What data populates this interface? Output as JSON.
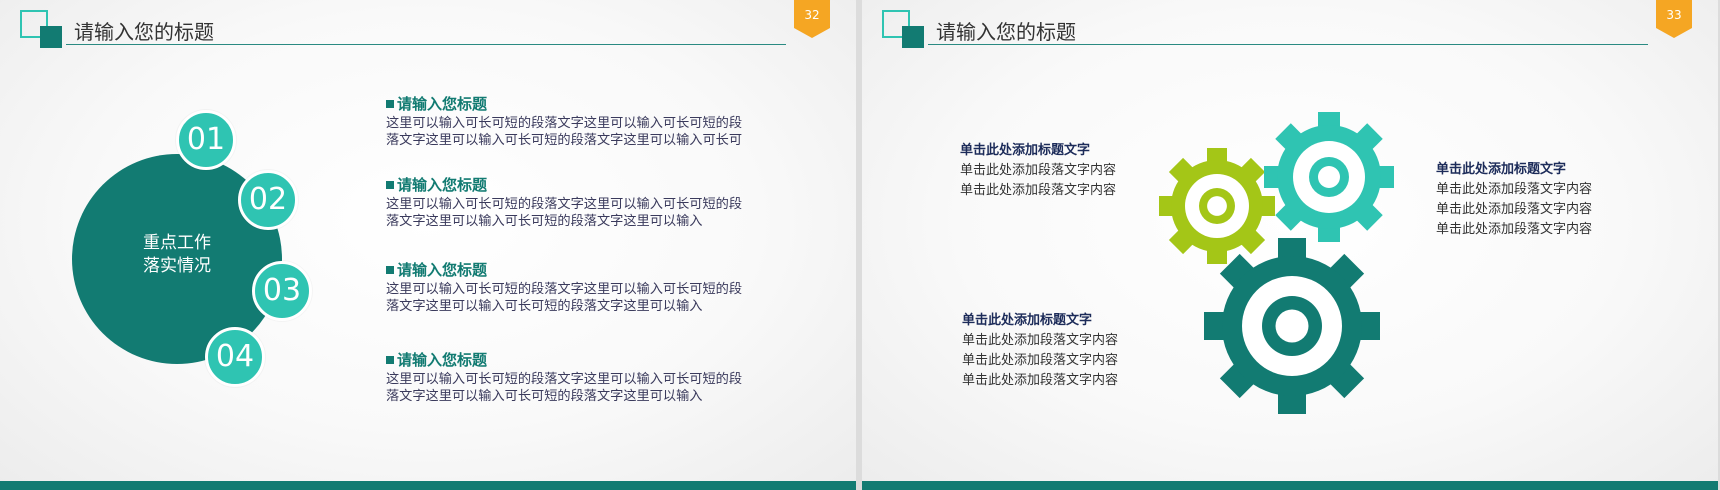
{
  "slides": [
    {
      "title": "请输入您的标题",
      "page_number": "32",
      "center_label": [
        "重点工作",
        "落实情况"
      ],
      "numbers": [
        "01",
        "02",
        "03",
        "04"
      ],
      "items": [
        {
          "title": "请输入您标题",
          "lines": [
            "这里可以输入可长可短的段落文字这里可以输入可长可短的段",
            "落文字这里可以输入可长可短的段落文字这里可以输入可长可"
          ]
        },
        {
          "title": "请输入您标题",
          "lines": [
            "这里可以输入可长可短的段落文字这里可以输入可长可短的段",
            "落文字这里可以输入可长可短的段落文字这里可以输入"
          ]
        },
        {
          "title": "请输入您标题",
          "lines": [
            "这里可以输入可长可短的段落文字这里可以输入可长可短的段",
            "落文字这里可以输入可长可短的段落文字这里可以输入"
          ]
        },
        {
          "title": "请输入您标题",
          "lines": [
            "这里可以输入可长可短的段落文字这里可以输入可长可短的段",
            "落文字这里可以输入可长可短的段落文字这里可以输入"
          ]
        }
      ]
    },
    {
      "title": "请输入您的标题",
      "page_number": "33",
      "text_blocks": [
        {
          "title": "单击此处添加标题文字",
          "lines": [
            "单击此处添加段落文字内容",
            "单击此处添加段落文字内容"
          ]
        },
        {
          "title": "单击此处添加标题文字",
          "lines": [
            "单击此处添加段落文字内容",
            "单击此处添加段落文字内容",
            "单击此处添加段落文字内容"
          ]
        },
        {
          "title": "单击此处添加标题文字",
          "lines": [
            "单击此处添加段落文字内容",
            "单击此处添加段落文字内容",
            "单击此处添加段落文字内容"
          ]
        }
      ],
      "gears": [
        {
          "name": "lime-gear-icon",
          "color": "#a4c617"
        },
        {
          "name": "teal-gear-icon",
          "color": "#2fc4b2"
        },
        {
          "name": "dark-teal-gear-icon",
          "color": "#127b72"
        }
      ]
    }
  ],
  "colors": {
    "dark_teal": "#127b72",
    "teal": "#2fc4b2",
    "lime": "#a4c617",
    "badge_orange": "#f5a623",
    "navy_text": "#1c2b59"
  }
}
